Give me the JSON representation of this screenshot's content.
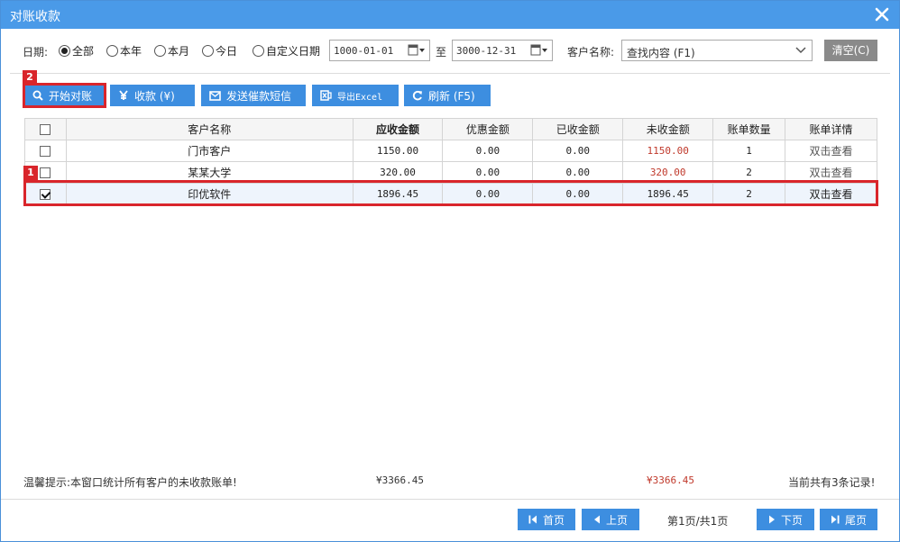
{
  "window": {
    "title": "对账收款",
    "close_icon": "close-icon"
  },
  "filter": {
    "date_label": "日期:",
    "radios": [
      {
        "label": "全部",
        "checked": true
      },
      {
        "label": "本年",
        "checked": false
      },
      {
        "label": "本月",
        "checked": false
      },
      {
        "label": "今日",
        "checked": false
      },
      {
        "label": "自定义日期",
        "checked": false
      }
    ],
    "date_from": "1000-01-01",
    "to_label": "至",
    "date_to": "3000-12-31",
    "customer_label": "客户名称:",
    "customer_value": "查找内容 (F1)",
    "clear_label": "清空(C)"
  },
  "toolbar": {
    "start_label": "开始对账",
    "collect_label": "收款 (¥)",
    "sms_label": "发送催款短信",
    "export_label": "导出Excel",
    "refresh_label": "刷新 (F5)"
  },
  "annotations": {
    "tag1": "1",
    "tag2": "2",
    "color": "#d9252b"
  },
  "table": {
    "headers": [
      "客户名称",
      "应收金额",
      "优惠金额",
      "已收金额",
      "未收金额",
      "账单数量",
      "账单详情"
    ],
    "rows": [
      {
        "checked": false,
        "customer": "门市客户",
        "receivable": "1150.00",
        "discount": "0.00",
        "received": "0.00",
        "unpaid": "1150.00",
        "count": "1",
        "detail": "双击查看"
      },
      {
        "checked": false,
        "customer": "某某大学",
        "receivable": "320.00",
        "discount": "0.00",
        "received": "0.00",
        "unpaid": "320.00",
        "count": "2",
        "detail": "双击查看"
      },
      {
        "checked": true,
        "customer": "印优软件",
        "receivable": "1896.45",
        "discount": "0.00",
        "received": "0.00",
        "unpaid": "1896.45",
        "count": "2",
        "detail": "双击查看"
      }
    ]
  },
  "summary": {
    "tip": "温馨提示:本窗口统计所有客户的未收款账单!",
    "total_receivable": "¥3366.45",
    "total_unpaid": "¥3366.45",
    "record_count": "当前共有3条记录!"
  },
  "pager": {
    "first_label": "首页",
    "prev_label": "上页",
    "page_info": "第1页/共1页",
    "next_label": "下页",
    "last_label": "尾页"
  },
  "colors": {
    "title_bar": "#4a9ae8",
    "button": "#3d8ee0",
    "unpaid_red": "#c0392b",
    "clear_button": "#8a8a8a"
  }
}
